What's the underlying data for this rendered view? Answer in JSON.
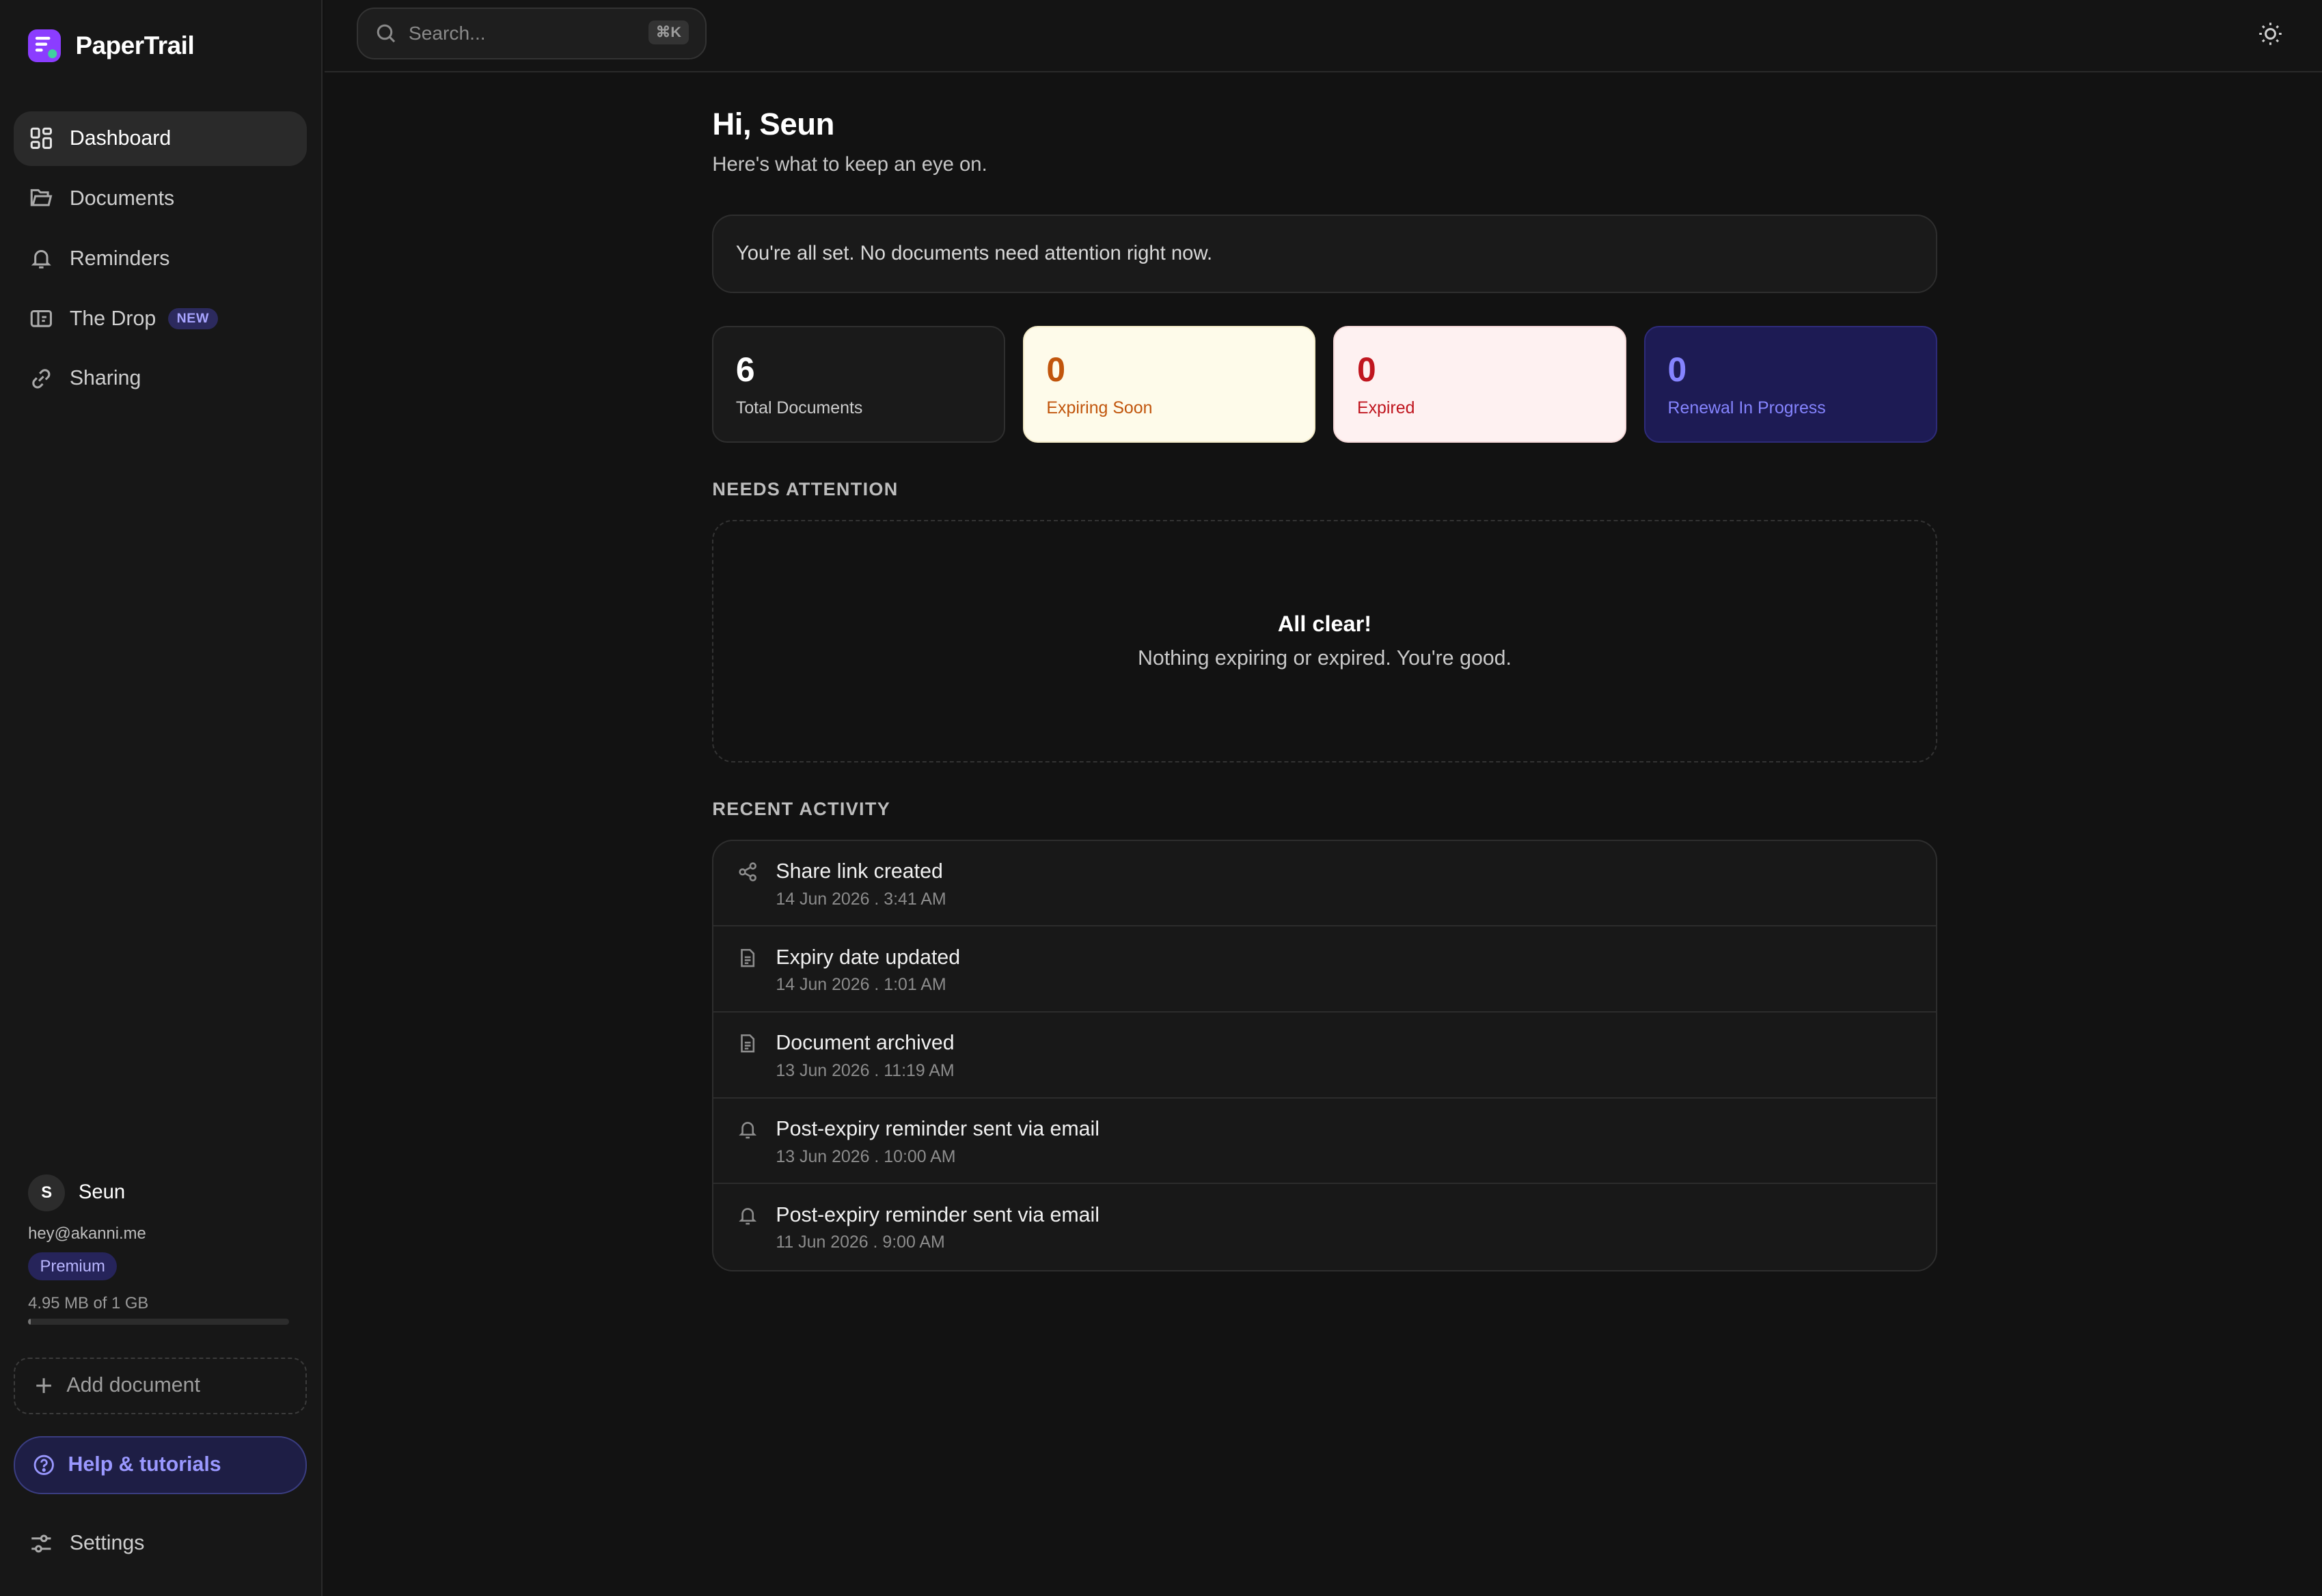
{
  "app": {
    "name": "PaperTrail"
  },
  "sidebar": {
    "items": [
      {
        "label": "Dashboard",
        "icon": "dashboard-icon",
        "active": true
      },
      {
        "label": "Documents",
        "icon": "folder-icon"
      },
      {
        "label": "Reminders",
        "icon": "bell-icon"
      },
      {
        "label": "The Drop",
        "icon": "drop-icon",
        "badge": "NEW"
      },
      {
        "label": "Sharing",
        "icon": "link-icon"
      }
    ],
    "user": {
      "initial": "S",
      "name": "Seun",
      "email": "hey@akanni.me",
      "plan": "Premium",
      "storage": "4.95 MB of 1 GB",
      "storage_fraction": 0.005
    },
    "add_document": "Add document",
    "help": "Help & tutorials",
    "settings": "Settings"
  },
  "topbar": {
    "search_placeholder": "Search...",
    "shortcut": "⌘K"
  },
  "main": {
    "greeting": "Hi, Seun",
    "subtitle": "Here's what to keep an eye on.",
    "notice": "You're all set. No documents need attention right now.",
    "stats": [
      {
        "value": "6",
        "label": "Total Documents"
      },
      {
        "value": "0",
        "label": "Expiring Soon"
      },
      {
        "value": "0",
        "label": "Expired"
      },
      {
        "value": "0",
        "label": "Renewal In Progress"
      }
    ],
    "needs_attention": {
      "title": "NEEDS ATTENTION",
      "empty_title": "All clear!",
      "empty_sub": "Nothing expiring or expired. You're good."
    },
    "recent_activity": {
      "title": "RECENT ACTIVITY",
      "items": [
        {
          "icon": "share-icon",
          "title": "Share link created",
          "time": "14 Jun 2026 . 3:41 AM"
        },
        {
          "icon": "document-icon",
          "title": "Expiry date updated",
          "time": "14 Jun 2026 . 1:01 AM"
        },
        {
          "icon": "document-icon",
          "title": "Document archived",
          "time": "13 Jun 2026 . 11:19 AM"
        },
        {
          "icon": "bell-icon",
          "title": "Post-expiry reminder sent via email",
          "time": "13 Jun 2026 . 10:00 AM"
        },
        {
          "icon": "bell-icon",
          "title": "Post-expiry reminder sent via email",
          "time": "11 Jun 2026 . 9:00 AM"
        }
      ]
    }
  },
  "colors": {
    "accent": "#8b3dff",
    "expiring": "#c1550c",
    "expired": "#c0161f",
    "renewal": "#8584ff"
  }
}
